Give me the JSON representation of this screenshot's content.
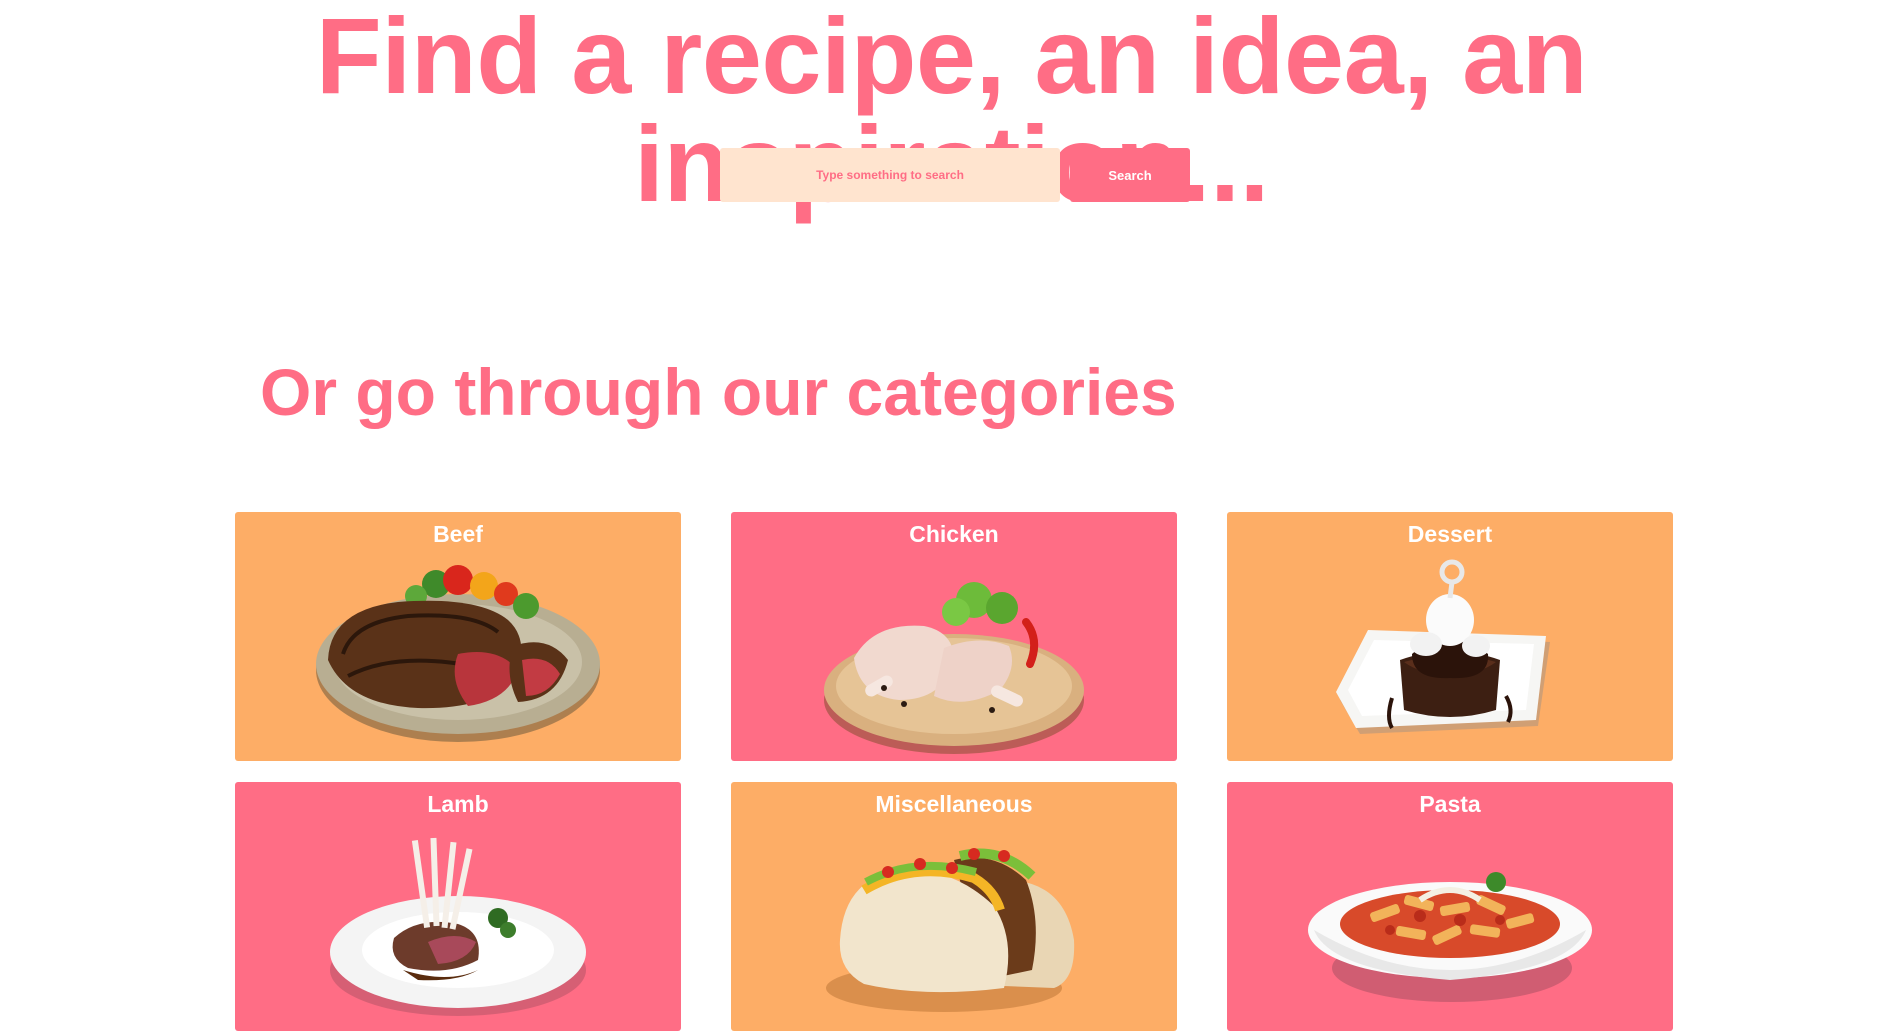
{
  "hero": {
    "title": "Find a recipe, an idea, an inspiration..."
  },
  "search": {
    "placeholder": "Type something to search",
    "value": "",
    "button_label": "Search"
  },
  "categories_section": {
    "title": "Or go through our categories",
    "items": [
      {
        "label": "Beef",
        "icon": "beef-steak-plate-image",
        "color": "#fdad66"
      },
      {
        "label": "Chicken",
        "icon": "raw-chicken-legs-board-image",
        "color": "#ff6d85"
      },
      {
        "label": "Dessert",
        "icon": "chocolate-cake-plate-image",
        "color": "#fdad66"
      },
      {
        "label": "Lamb",
        "icon": "lamb-chops-plate-image",
        "color": "#ff6d85"
      },
      {
        "label": "Miscellaneous",
        "icon": "tacos-image",
        "color": "#fdad66"
      },
      {
        "label": "Pasta",
        "icon": "penne-pasta-bowl-image",
        "color": "#ff6d85"
      }
    ]
  },
  "colors": {
    "accent": "#ff6d85",
    "orange": "#fdad66",
    "input_bg": "#ffe4cf"
  }
}
